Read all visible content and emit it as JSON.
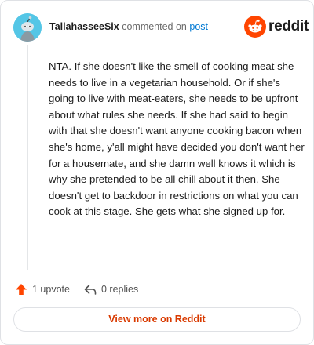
{
  "header": {
    "username": "TallahasseeSix",
    "verb": "commented on",
    "post_link": "post",
    "brand_word": "reddit",
    "brand_logo_icon": "reddit-alien-icon",
    "avatar_icon": "snoo-avatar-icon"
  },
  "comment": {
    "text": "NTA. If she doesn't like the smell of cooking meat she needs to live in a vegetarian household. Or if she's going to live with meat-eaters, she needs to be upfront about what rules she needs. If she had said to begin with that she doesn't want anyone cooking bacon when she's home, y'all might have decided you don't want her for a housemate, and she damn well knows it which is why she pretended to be all chill about it then. She doesn't get to backdoor in restrictions on what you can cook at this stage. She gets what she signed up for."
  },
  "actions": {
    "upvote_label": "1 upvote",
    "upvote_icon": "upvote-arrow-icon",
    "replies_label": "0 replies",
    "replies_icon": "reply-arrow-icon"
  },
  "footer": {
    "view_more_label": "View more on Reddit"
  },
  "colors": {
    "brand_orange": "#ff4500",
    "link_blue": "#0079d3",
    "cta_red": "#d93a00",
    "avatar_bg": "#54c6e6"
  }
}
